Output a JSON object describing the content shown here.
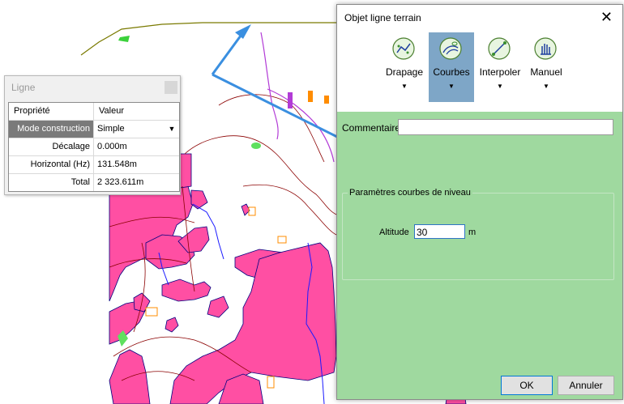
{
  "ligne_panel": {
    "title": "Ligne",
    "header": {
      "property": "Propriété",
      "value": "Valeur"
    },
    "rows": [
      {
        "label": "Mode construction",
        "value": "Simple"
      },
      {
        "label": "Décalage",
        "value": "0.000m"
      },
      {
        "label": "Horizontal (Hz)",
        "value": "131.548m"
      },
      {
        "label": "Total",
        "value": "2 323.611m"
      }
    ]
  },
  "dialog": {
    "title": "Objet ligne terrain",
    "close_glyph": "✕",
    "tools": [
      {
        "label": "Drapage",
        "icon": "drape-icon",
        "arrow": "▼"
      },
      {
        "label": "Courbes",
        "icon": "contour-curves-icon",
        "arrow": "▼",
        "active": true
      },
      {
        "label": "Interpoler",
        "icon": "interpolate-icon",
        "arrow": "▼"
      },
      {
        "label": "Manuel",
        "icon": "manual-hand-icon",
        "arrow": "▼"
      }
    ],
    "comment_label": "Commentaire",
    "comment_value": "",
    "group_title": "Paramètres courbes de niveau",
    "altitude_label": "Altitude",
    "altitude_value": "30",
    "altitude_unit": "m",
    "ok_label": "OK",
    "cancel_label": "Annuler"
  },
  "colors": {
    "dialog_bg": "#9fd99f",
    "active_tool": "#7ea6c7",
    "map_magenta": "#ff4fa3",
    "map_contour": "#8b0000",
    "map_blue": "#1a1aff",
    "arrow": "#3a8fe0"
  }
}
